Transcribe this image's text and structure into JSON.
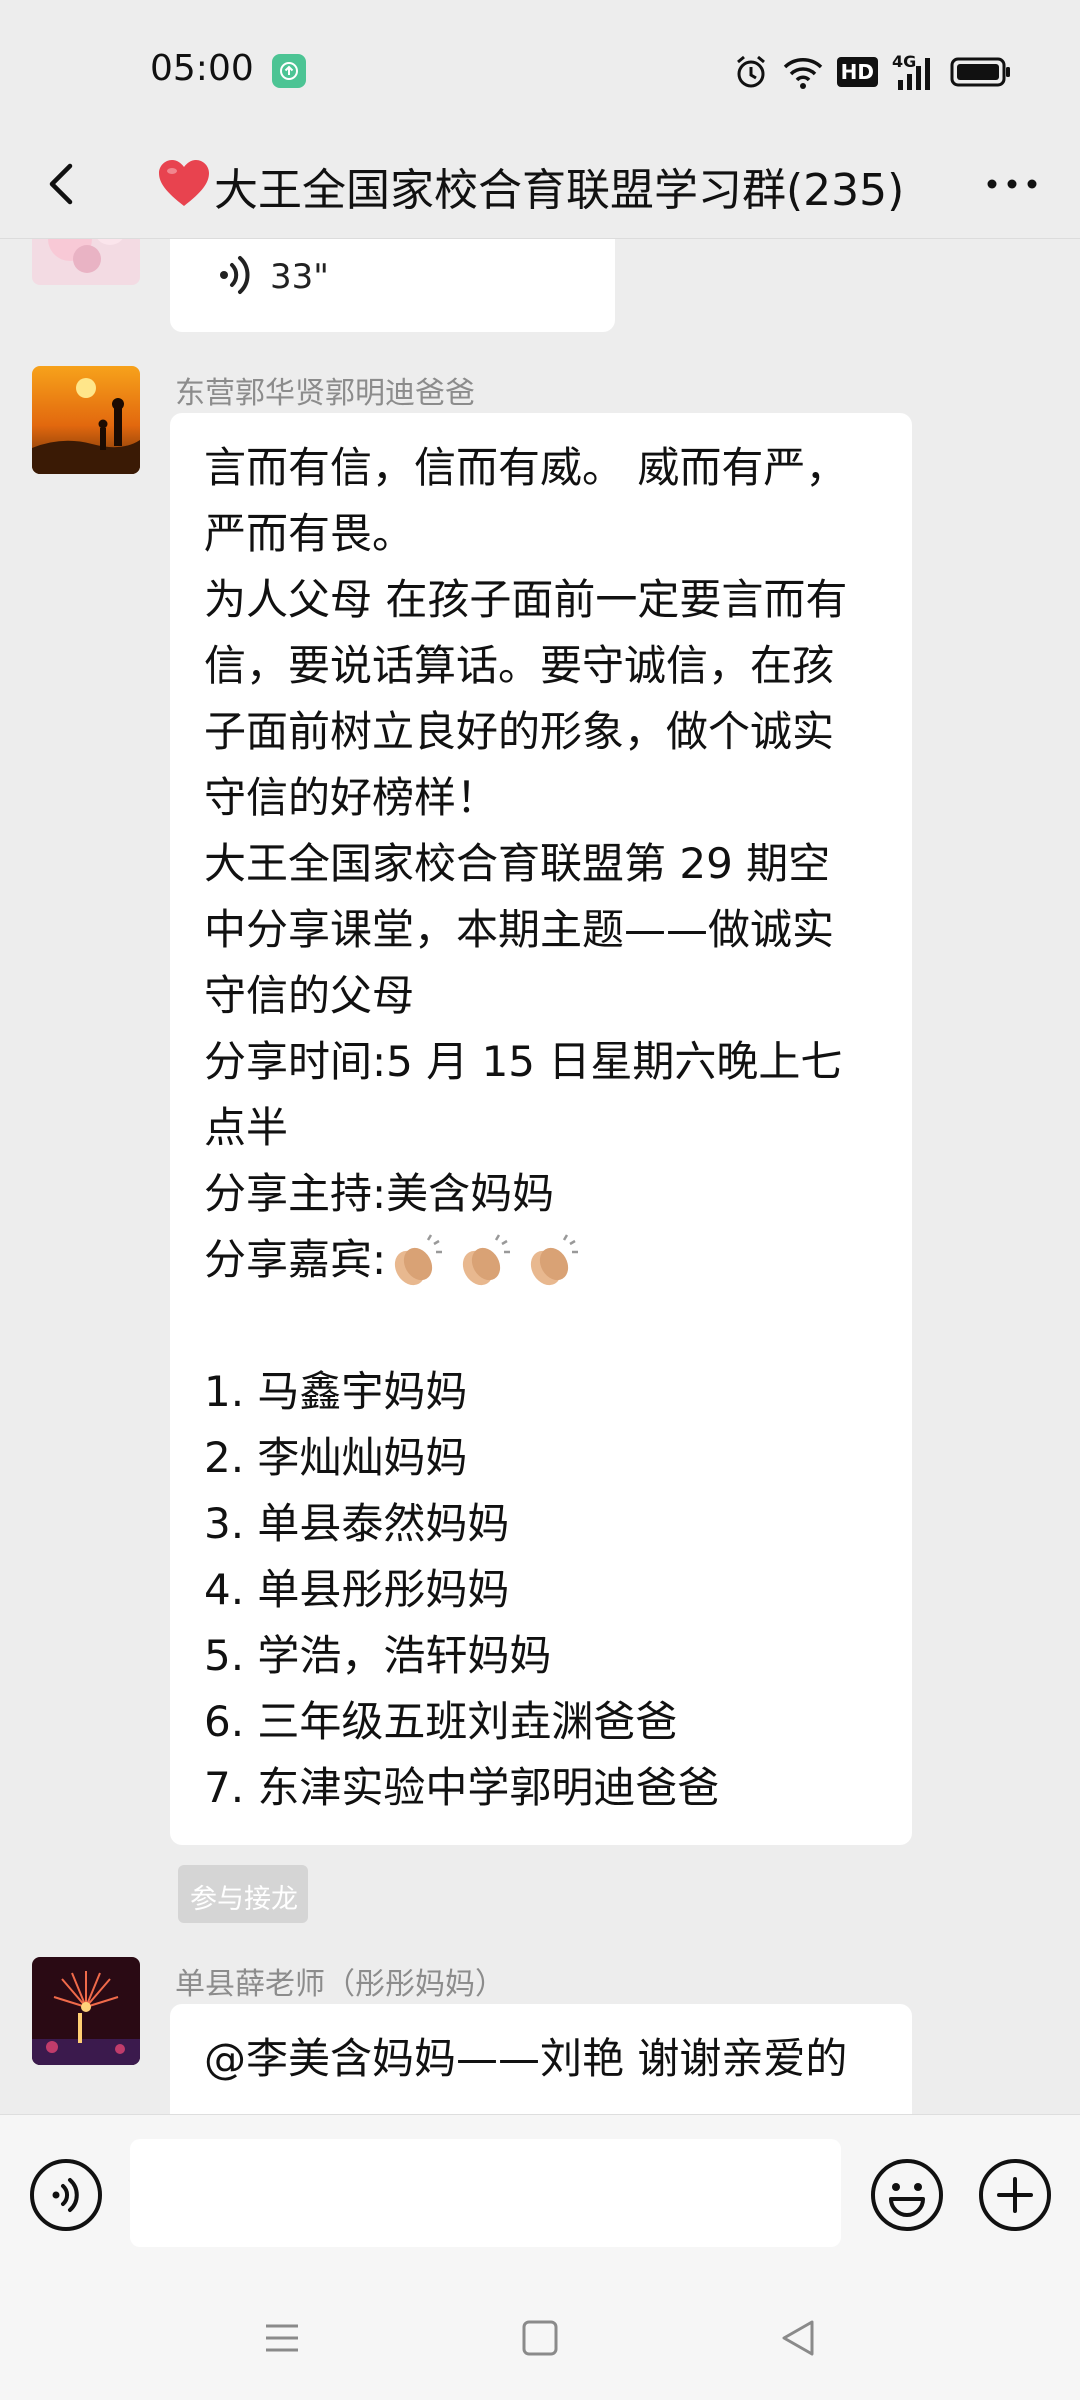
{
  "status_bar": {
    "time": "05:00",
    "network": "4G",
    "hd": "HD",
    "icons": [
      "upload-notification-icon",
      "alarm-icon",
      "wifi-icon",
      "hd-icon",
      "signal-icon",
      "battery-icon"
    ]
  },
  "header": {
    "title": "大王全国家校合育联盟学习群(235)",
    "icons": [
      "back-icon",
      "heart-icon",
      "more-icon"
    ]
  },
  "messages": [
    {
      "type": "voice",
      "duration": "33\""
    },
    {
      "type": "text",
      "sender": "东营郭华贤郭明迪爸爸",
      "lines": [
        "言而有信，信而有威。 威而有严，",
        "严而有畏。",
        "为人父母 在孩子面前一定要言而有",
        "信，要说话算话。要守诚信，在孩",
        "子面前树立良好的形象，做个诚实",
        "守信的好榜样！",
        "大王全国家校合育联盟第 29 期空",
        "中分享课堂，本期主题——做诚实",
        "守信的父母",
        "分享时间:5 月 15 日星期六晚上七",
        "点半",
        "分享主持:美含妈妈",
        "分享嘉宾:",
        "",
        "1. 马鑫宇妈妈",
        "2. 李灿灿妈妈",
        "3. 单县泰然妈妈",
        "4. 单县彤彤妈妈",
        "5. 学浩，浩轩妈妈",
        "6. 三年级五班刘垚渊爸爸",
        "7. 东津实验中学郭明迪爸爸"
      ],
      "action_tag": "参与接龙"
    },
    {
      "type": "text",
      "sender": "单县薛老师（彤彤妈妈）",
      "lines": [
        "@李美含妈妈——刘艳  谢谢亲爱的"
      ]
    }
  ],
  "input_bar": {
    "placeholder": "",
    "icons": [
      "voice-input-icon",
      "emoji-icon",
      "plus-icon"
    ]
  },
  "nav_bar": {
    "icons": [
      "menu-icon",
      "home-icon",
      "back-triangle-icon"
    ]
  },
  "colors": {
    "background": "#ededed",
    "bubble": "#ffffff",
    "sender_text": "#8c8c8c",
    "app_dot": "#4cc494",
    "heart": "#e8434f"
  }
}
